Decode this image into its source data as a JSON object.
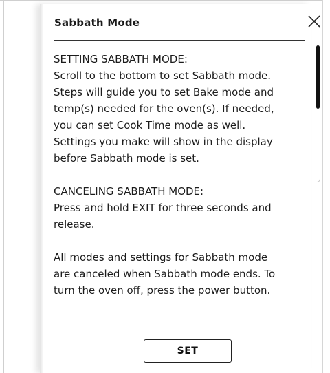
{
  "dialog": {
    "title": "Sabbath Mode",
    "body": {
      "setting_heading": "SETTING SABBATH MODE:",
      "setting_lines": [
        "Scroll to the bottom to set Sabbath mode.",
        "Steps will guide you to set Bake mode and",
        "temp(s) needed for the oven(s). If needed,",
        "you can set Cook Time mode as well.",
        "Settings you make will show in the display",
        "before Sabbath mode is set."
      ],
      "canceling_heading": "CANCELING SABBATH MODE:",
      "canceling_lines": [
        "Press and hold EXIT for three seconds and",
        "release."
      ],
      "note_lines": [
        "All modes and settings for Sabbath mode",
        "are canceled when Sabbath mode ends. To",
        "turn the oven off, press the power button."
      ]
    },
    "set_label": "SET",
    "close_icon": "close-icon"
  }
}
